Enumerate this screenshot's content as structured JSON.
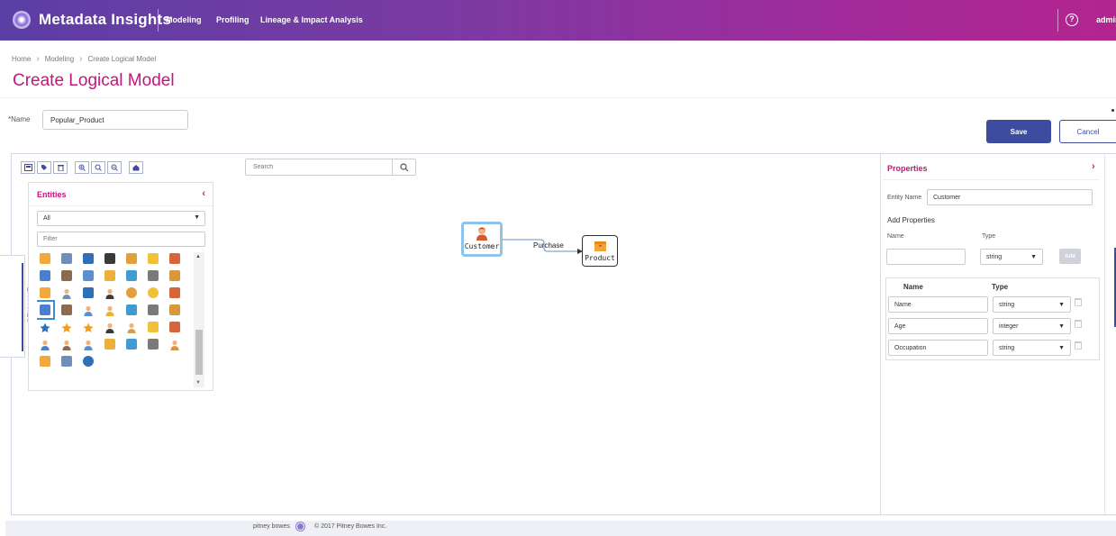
{
  "app": {
    "title": "Metadata Insights",
    "nav": [
      "Modeling",
      "Profiling",
      "Lineage & Impact Analysis"
    ],
    "help_glyph": "?",
    "user": "admin"
  },
  "breadcrumb": [
    "Home",
    "Modeling",
    "Create Logical Model"
  ],
  "page": {
    "title": "Create Logical Model",
    "name_label": "*Name",
    "name_value": "Popular_Product",
    "save_label": "Save",
    "cancel_label": "Cancel"
  },
  "toolbar": {
    "tools": [
      "save-icon",
      "tag-icon",
      "delete-icon",
      "zoom-in-icon",
      "zoom-fit-icon",
      "zoom-out-icon",
      "home-icon"
    ]
  },
  "search": {
    "placeholder": "Search"
  },
  "entities": {
    "tab_label": "ENTITIES",
    "title": "Entities",
    "filter_value": "All",
    "filter_placeholder": "Filter"
  },
  "diagram": {
    "nodes": [
      {
        "label": "Customer",
        "icon": "person-icon"
      },
      {
        "label": "Product",
        "icon": "box-icon"
      }
    ],
    "edge_label": "Purchase"
  },
  "properties": {
    "title": "Properties",
    "entity_name_label": "Entity Name",
    "entity_name_value": "Customer",
    "add_heading": "Add Properties",
    "name_label": "Name",
    "type_label": "Type",
    "new_type_value": "string",
    "add_label": "Add",
    "table_headers": [
      "Name",
      "Type"
    ],
    "rows": [
      {
        "name": "Name",
        "type": "string"
      },
      {
        "name": "Age",
        "type": "integer"
      },
      {
        "name": "Occupation",
        "type": "string"
      }
    ]
  },
  "footer": {
    "brand": "pitney bowes",
    "copyright": "© 2017 Pitney Bowes Inc."
  },
  "colors": {
    "accent": "#c2177a",
    "primary": "#3e4ca0",
    "selection": "#8fc4ea"
  }
}
